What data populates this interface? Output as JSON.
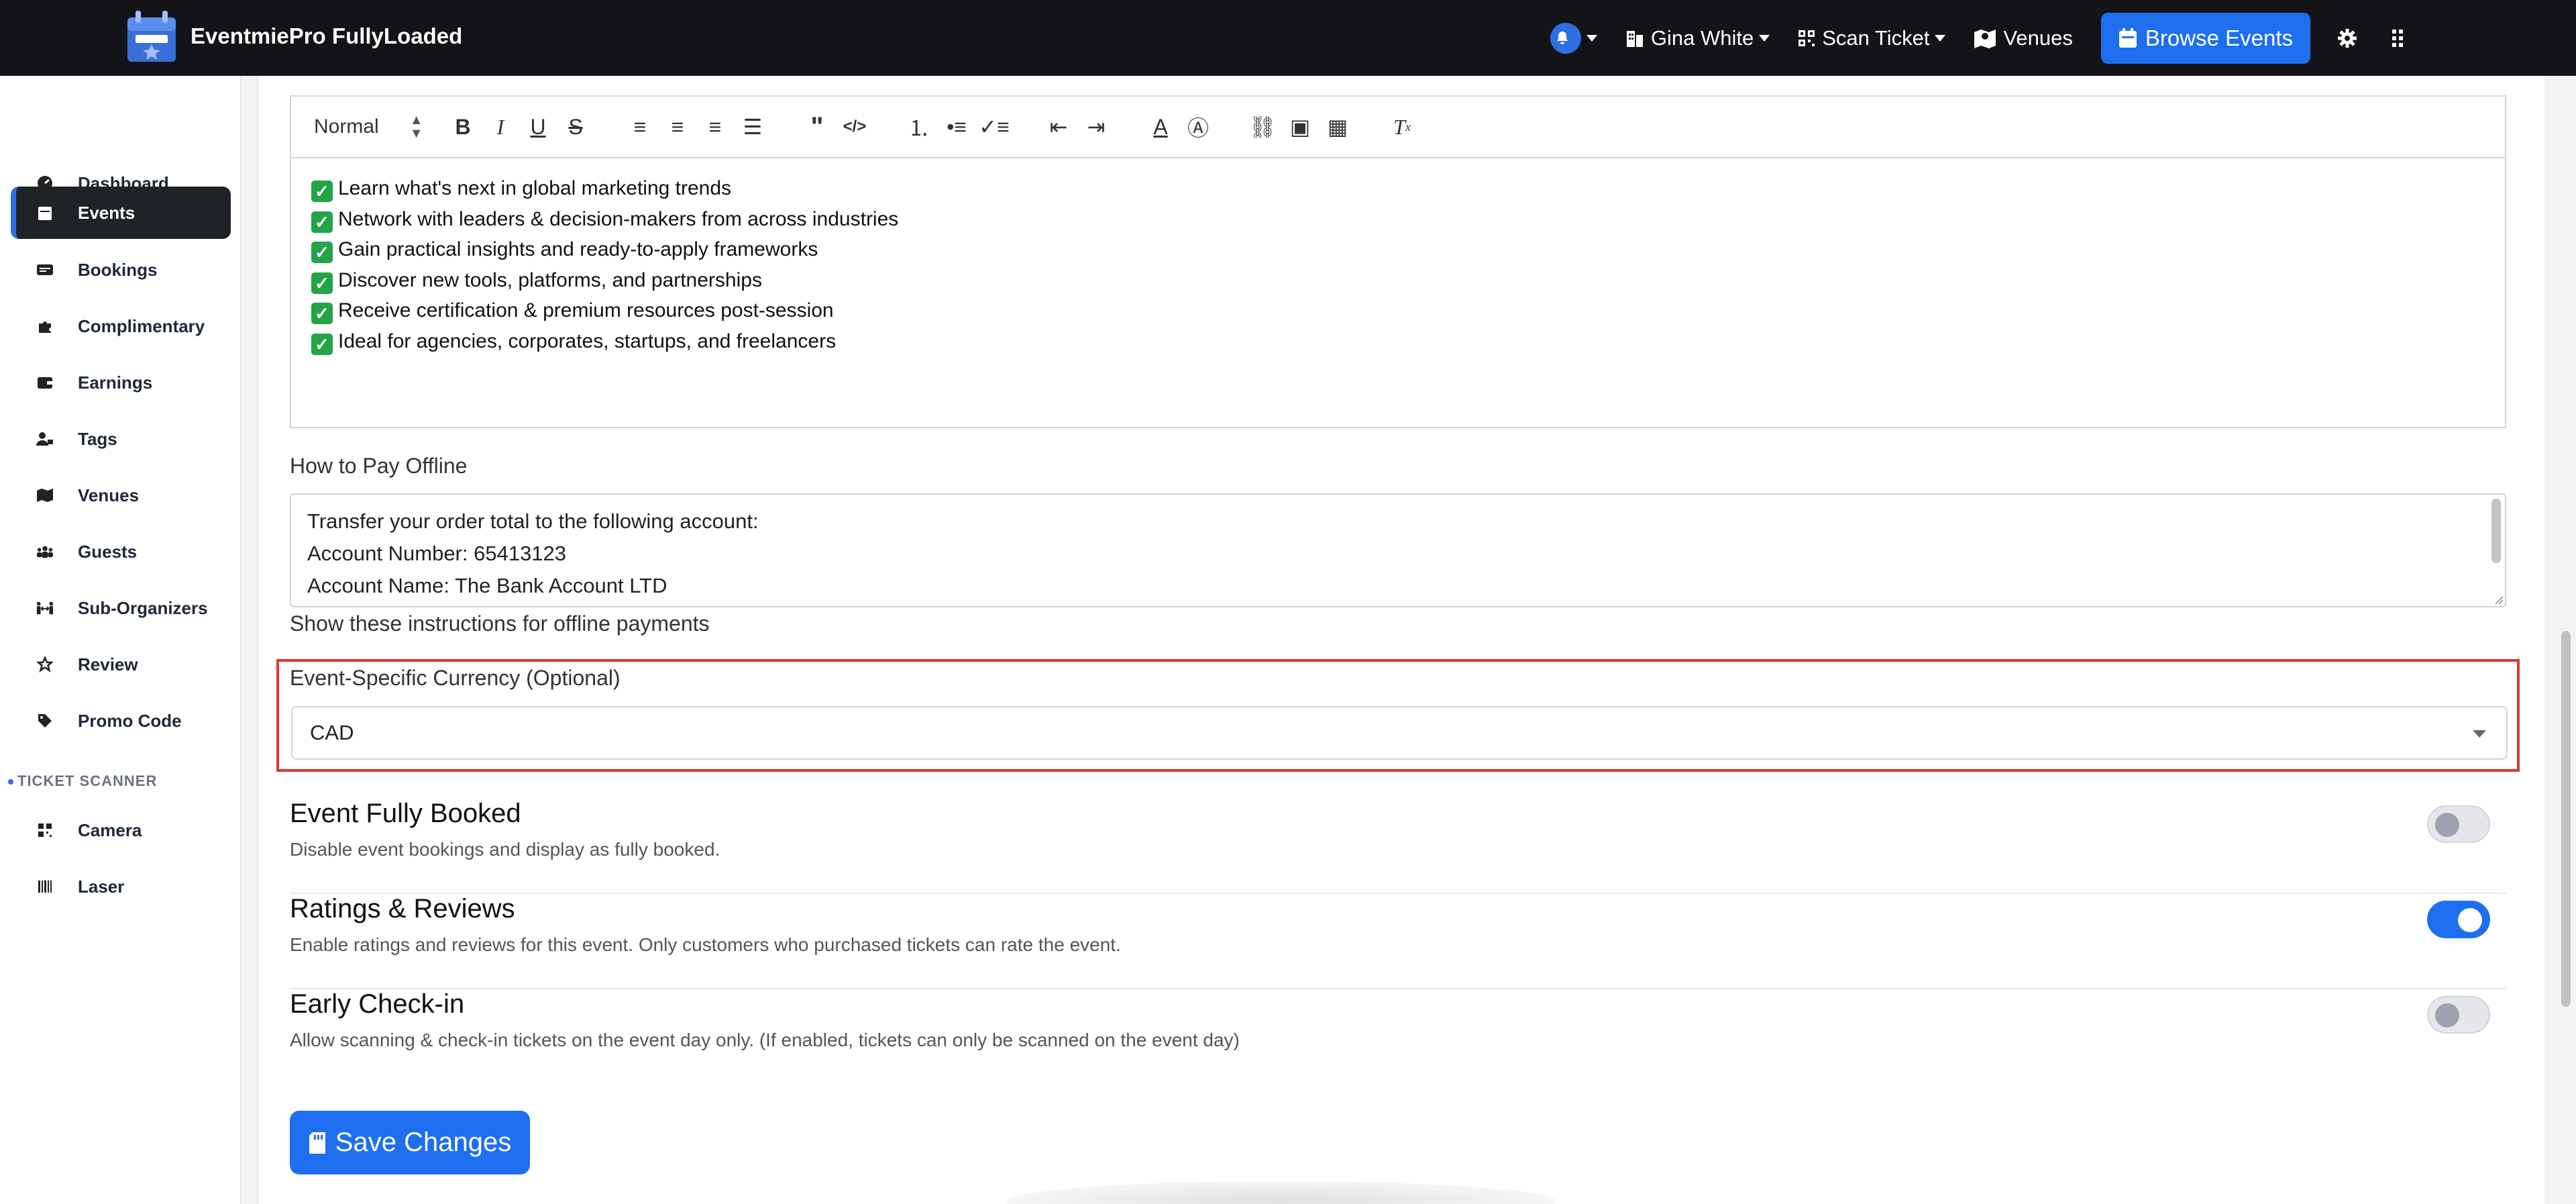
{
  "app": {
    "brand_name": "EventmiePro FullyLoaded"
  },
  "topnav": {
    "user_name": "Gina White",
    "scan_ticket": "Scan Ticket",
    "venues": "Venues",
    "browse_events": "Browse Events",
    "icons": [
      "bell-icon",
      "user-building-icon",
      "qrcode-icon",
      "map-icon",
      "calendar-icon",
      "gear-icon",
      "grid-icon"
    ],
    "accent_color": "#1e6ff0"
  },
  "sidebar": {
    "items": [
      {
        "label": "Dashboard",
        "icon": "gauge-icon",
        "active": false
      },
      {
        "label": "Events",
        "icon": "calendar-icon",
        "active": true
      },
      {
        "label": "Bookings",
        "icon": "ticket-icon",
        "active": false
      },
      {
        "label": "Complimentary",
        "icon": "puzzle-icon",
        "active": false
      },
      {
        "label": "Earnings",
        "icon": "wallet-icon",
        "active": false
      },
      {
        "label": "Tags",
        "icon": "user-tag-icon",
        "active": false
      },
      {
        "label": "Venues",
        "icon": "map-icon",
        "active": false
      },
      {
        "label": "Guests",
        "icon": "users-icon",
        "active": false
      },
      {
        "label": "Sub-Organizers",
        "icon": "people-arrows-icon",
        "active": false
      },
      {
        "label": "Review",
        "icon": "star-icon",
        "active": false
      },
      {
        "label": "Promo Code",
        "icon": "tag-icon",
        "active": false
      }
    ],
    "scanner_heading": "TICKET SCANNER",
    "scanner_items": [
      {
        "label": "Camera",
        "icon": "qrcode-icon"
      },
      {
        "label": "Laser",
        "icon": "barcode-icon"
      }
    ]
  },
  "editor": {
    "format_select": "Normal",
    "lines": [
      "Learn what's next in global marketing trends",
      "Network with leaders & decision-makers from across industries",
      "Gain practical insights and ready-to-apply frameworks",
      "Discover new tools, platforms, and partnerships",
      "Receive certification & premium resources post-session",
      "Ideal for agencies, corporates, startups, and freelancers"
    ]
  },
  "offline": {
    "label": "How to Pay Offline",
    "lines": [
      "Transfer your order total to the following account:",
      "Account Number: 65413123",
      "Account Name: The Bank Account LTD"
    ],
    "help": "Show these instructions for offline payments"
  },
  "currency": {
    "label": "Event-Specific Currency (Optional)",
    "value": "CAD",
    "highlight_color": "#e0382a"
  },
  "toggles": [
    {
      "title": "Event Fully Booked",
      "desc": "Disable event bookings and display as fully booked.",
      "on": false
    },
    {
      "title": "Ratings & Reviews",
      "desc": "Enable ratings and reviews for this event. Only customers who purchased tickets can rate the event.",
      "on": true
    },
    {
      "title": "Early Check-in",
      "desc": "Allow scanning & check-in tickets on the event day only. (If enabled, tickets can only be scanned on the event day)",
      "on": false
    }
  ],
  "save_button": "Save Changes"
}
